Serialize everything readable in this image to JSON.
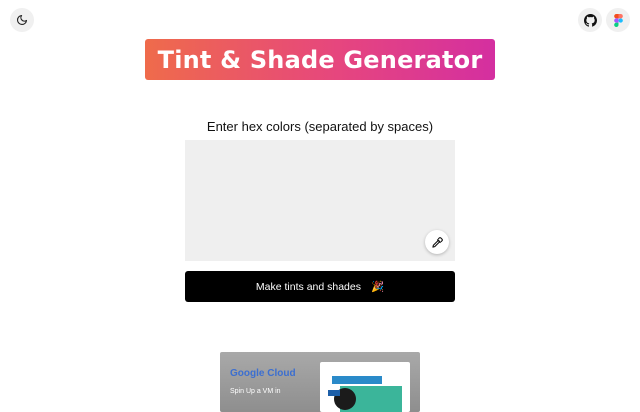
{
  "header": {
    "title": "Tint & Shade Generator",
    "theme_icon": "moon-icon",
    "github_icon": "github-icon",
    "figma_icon": "figma-icon"
  },
  "form": {
    "label": "Enter hex colors (separated by spaces)",
    "textarea_value": "",
    "textarea_placeholder": "",
    "eyedropper_icon": "eyedropper-icon",
    "submit_label": "Make tints and shades",
    "submit_emoji": "🎉"
  },
  "ad": {
    "logo_text": "Google Cloud",
    "tagline": "Spin Up a VM in"
  },
  "colors": {
    "gradient_start": "#ef6b4b",
    "gradient_end": "#d42fa0",
    "button_bg": "#000000",
    "textarea_bg": "#efefef"
  }
}
